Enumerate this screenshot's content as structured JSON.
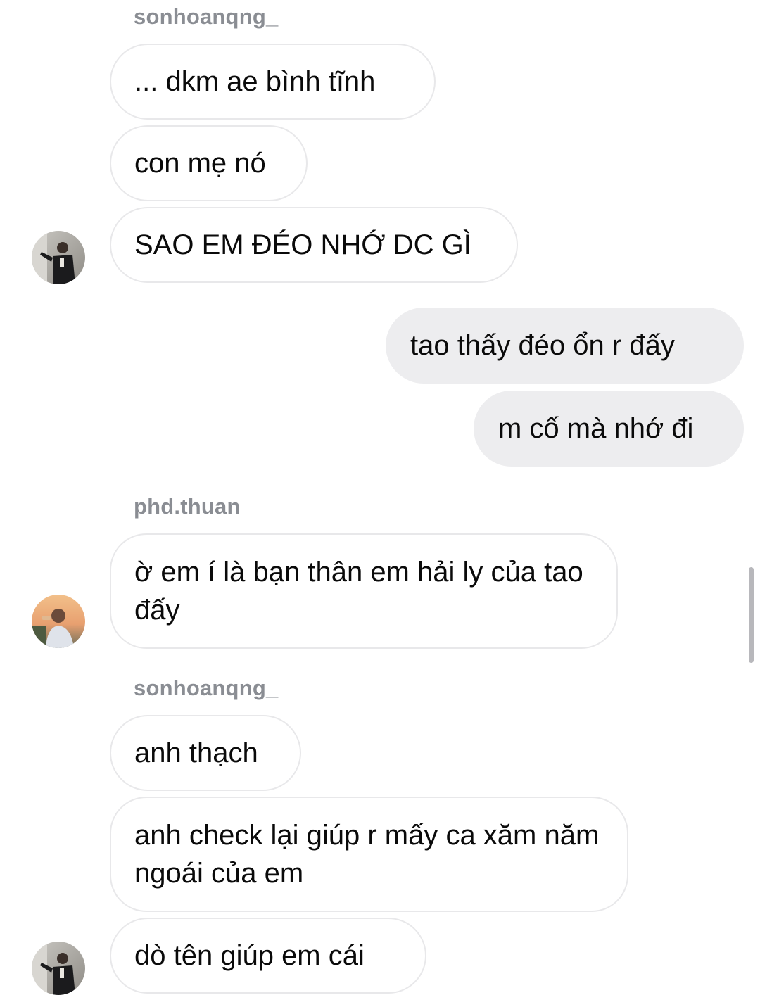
{
  "conversation": {
    "group1": {
      "sender": "sonhoanqng_",
      "messages": [
        "... dkm ae bình tĩnh",
        "con mẹ nó",
        "SAO EM ĐÉO NHỚ DC GÌ"
      ]
    },
    "self": {
      "messages": [
        "tao thấy đéo ổn r đấy",
        "m cố mà nhớ đi"
      ]
    },
    "group2": {
      "sender": "phd.thuan",
      "messages": [
        "ờ em í là bạn thân em hải ly của tao đấy"
      ]
    },
    "group3": {
      "sender": "sonhoanqng_",
      "messages": [
        "anh thạch",
        "anh check lại giúp r mấy ca xăm năm ngoái của em",
        "dò tên giúp em cái"
      ]
    }
  },
  "colors": {
    "incoming_bubble": "#ffffff",
    "outgoing_bubble": "#ededef",
    "sender_name": "#8a8d93",
    "text": "#0a0a0a"
  }
}
